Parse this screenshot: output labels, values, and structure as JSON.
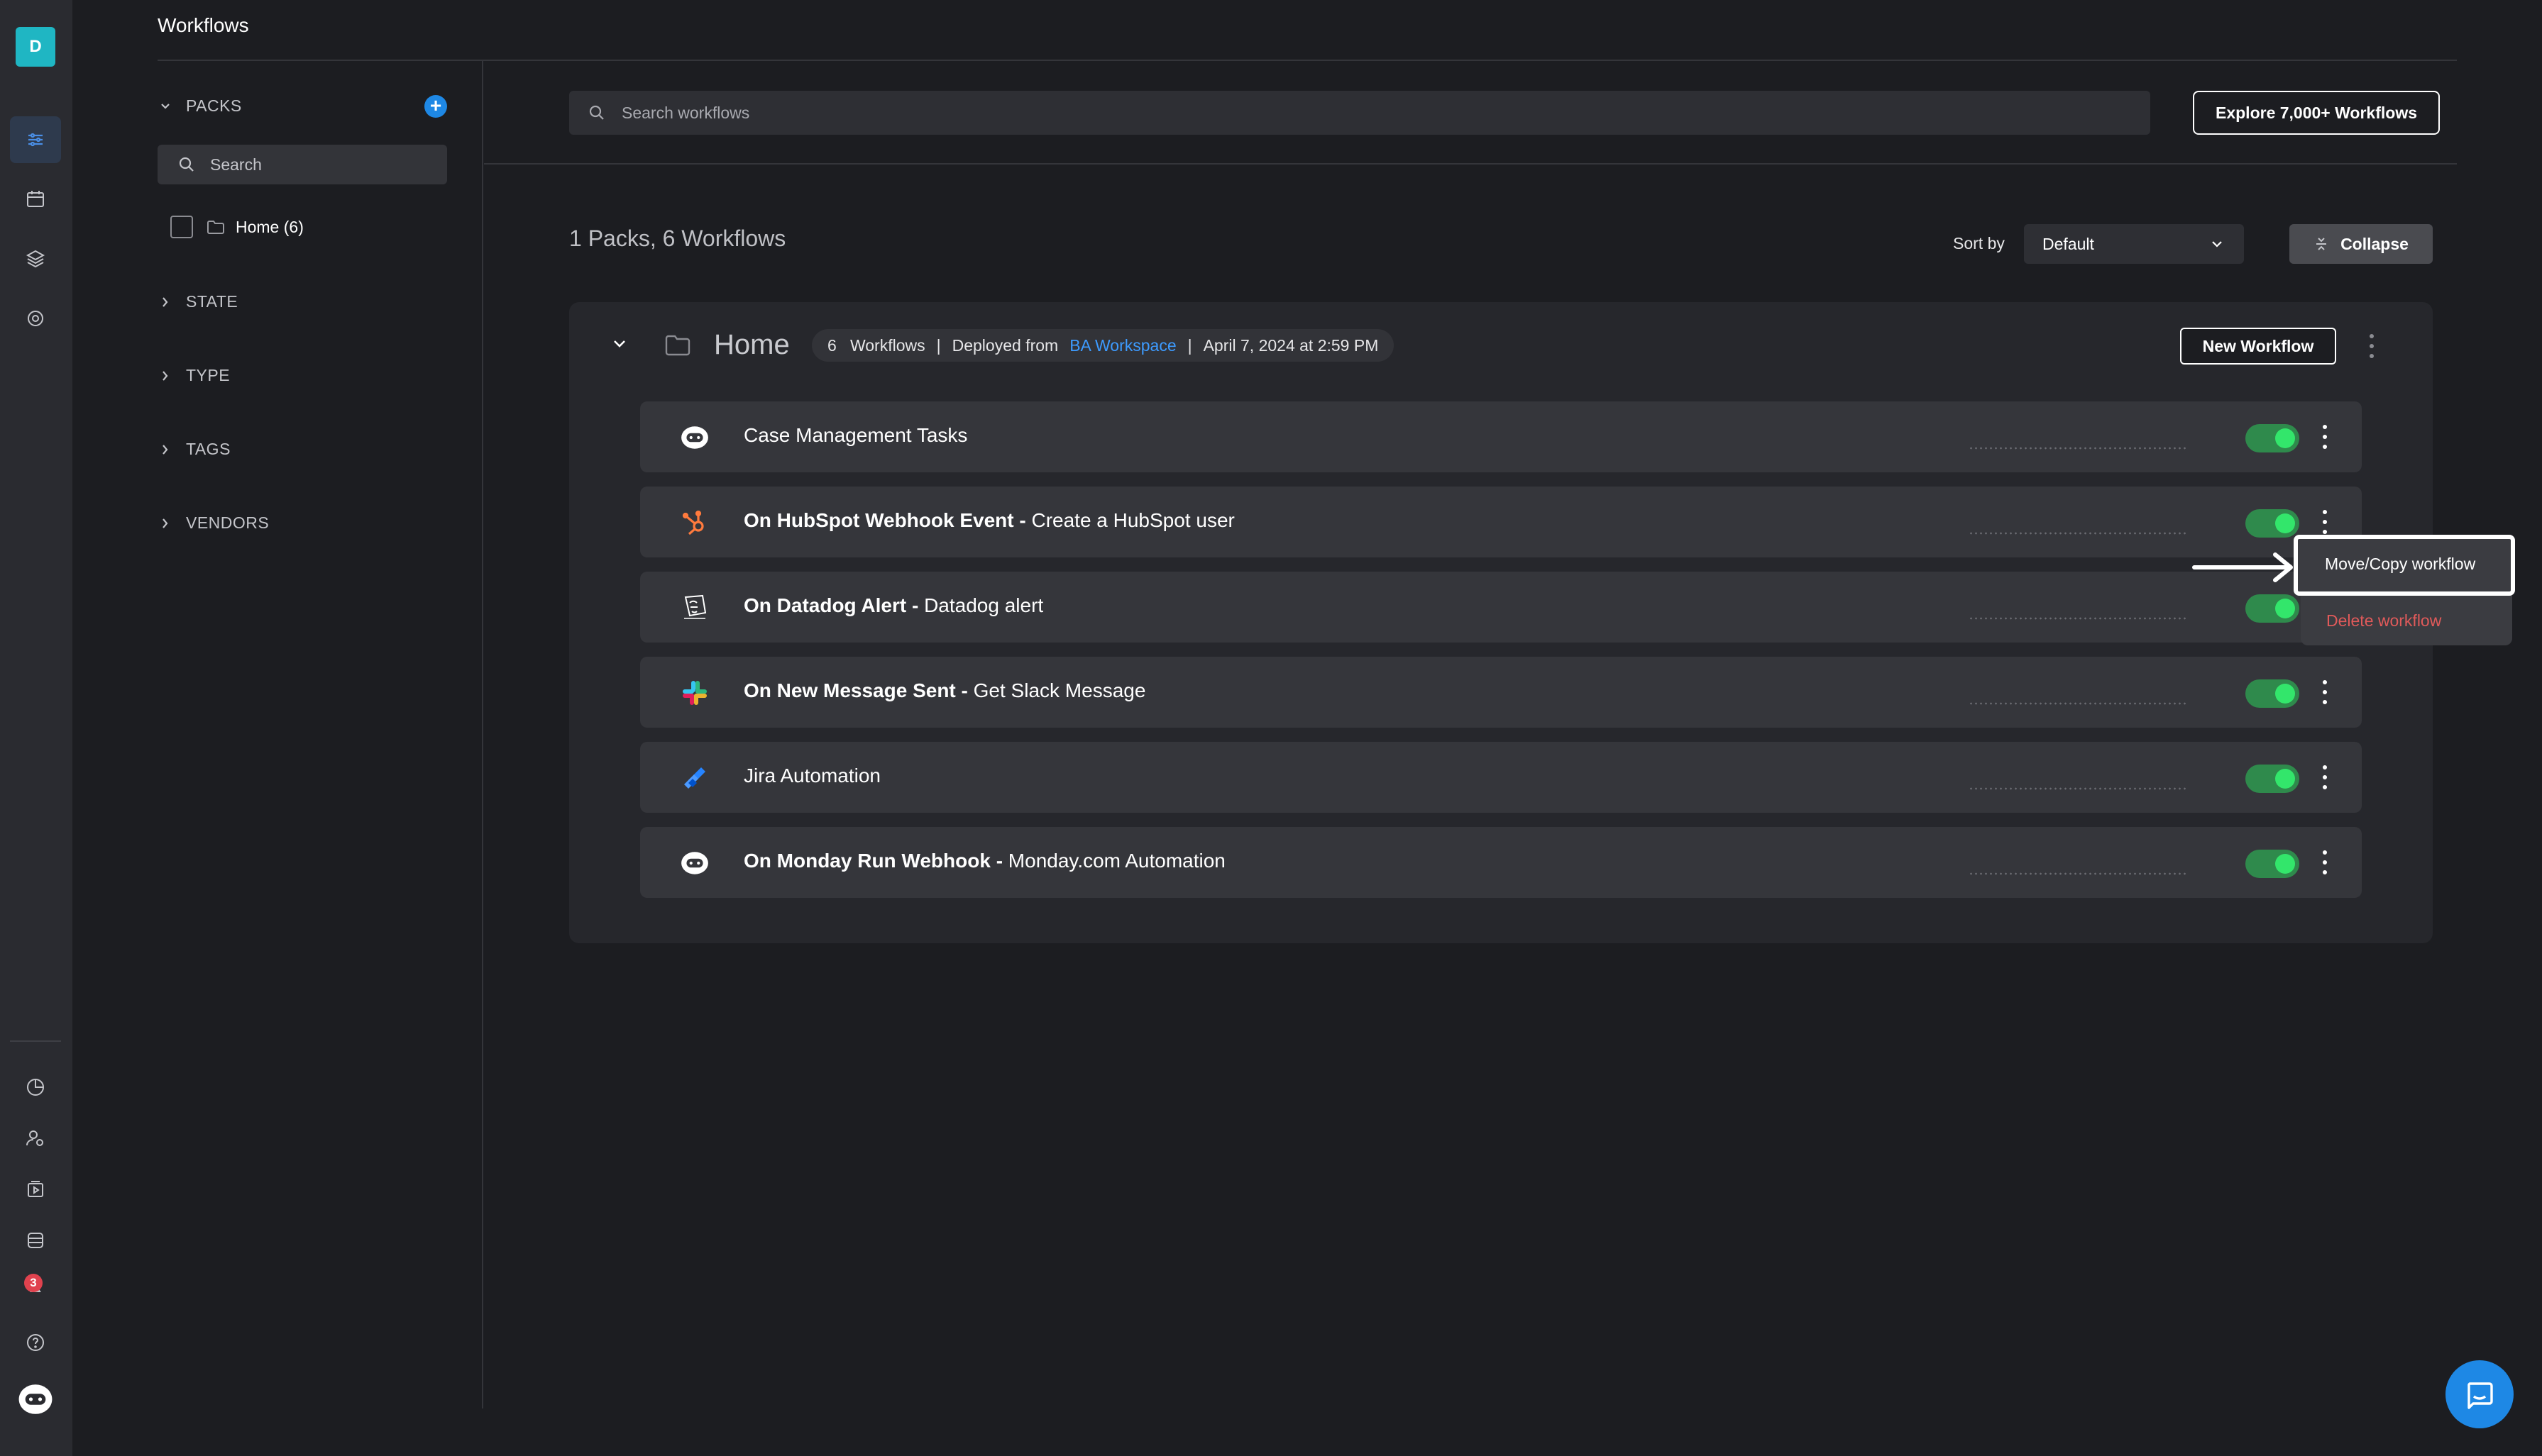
{
  "app": {
    "title": "Workflows",
    "user_initial": "D",
    "notification_count": "3"
  },
  "filters": {
    "sections": [
      {
        "label": "PACKS",
        "expanded": true
      },
      {
        "label": "STATE",
        "expanded": false
      },
      {
        "label": "TYPE",
        "expanded": false
      },
      {
        "label": "TAGS",
        "expanded": false
      },
      {
        "label": "VENDORS",
        "expanded": false
      }
    ],
    "search_placeholder": "Search",
    "packs": [
      {
        "label": "Home (6)",
        "checked": false
      }
    ]
  },
  "main": {
    "search_placeholder": "Search workflows",
    "explore_label": "Explore 7,000+ Workflows",
    "summary": "1 Packs, 6 Workflows",
    "sort_label": "Sort by",
    "sort_value": "Default",
    "collapse_label": "Collapse"
  },
  "pack": {
    "title": "Home",
    "workflow_count": "6",
    "workflows_word": "Workflows",
    "deployed_from_label": "Deployed from",
    "workspace": "BA Workspace",
    "date": "April 7, 2024 at 2:59 PM",
    "new_workflow_label": "New Workflow",
    "workflows": [
      {
        "trigger": "",
        "name": "Case Management Tasks",
        "icon": "bot-icon",
        "enabled": true
      },
      {
        "trigger": "On HubSpot Webhook Event - ",
        "name": "Create a HubSpot user",
        "icon": "hubspot-icon",
        "enabled": true
      },
      {
        "trigger": "On Datadog Alert - ",
        "name": "Datadog alert",
        "icon": "datadog-icon",
        "enabled": true
      },
      {
        "trigger": "On New Message Sent - ",
        "name": "Get Slack Message",
        "icon": "slack-icon",
        "enabled": true
      },
      {
        "trigger": "",
        "name": "Jira Automation",
        "icon": "jira-icon",
        "enabled": true
      },
      {
        "trigger": "On Monday Run Webhook - ",
        "name": "Monday.com Automation",
        "icon": "bot-icon",
        "enabled": true
      }
    ]
  },
  "context_menu": {
    "move_copy": "Move/Copy workflow",
    "delete": "Delete workflow"
  },
  "colors": {
    "accent": "#1e88e5",
    "toggle_on": "#33e66b",
    "link": "#3d9bff",
    "danger": "#e05a5a"
  }
}
